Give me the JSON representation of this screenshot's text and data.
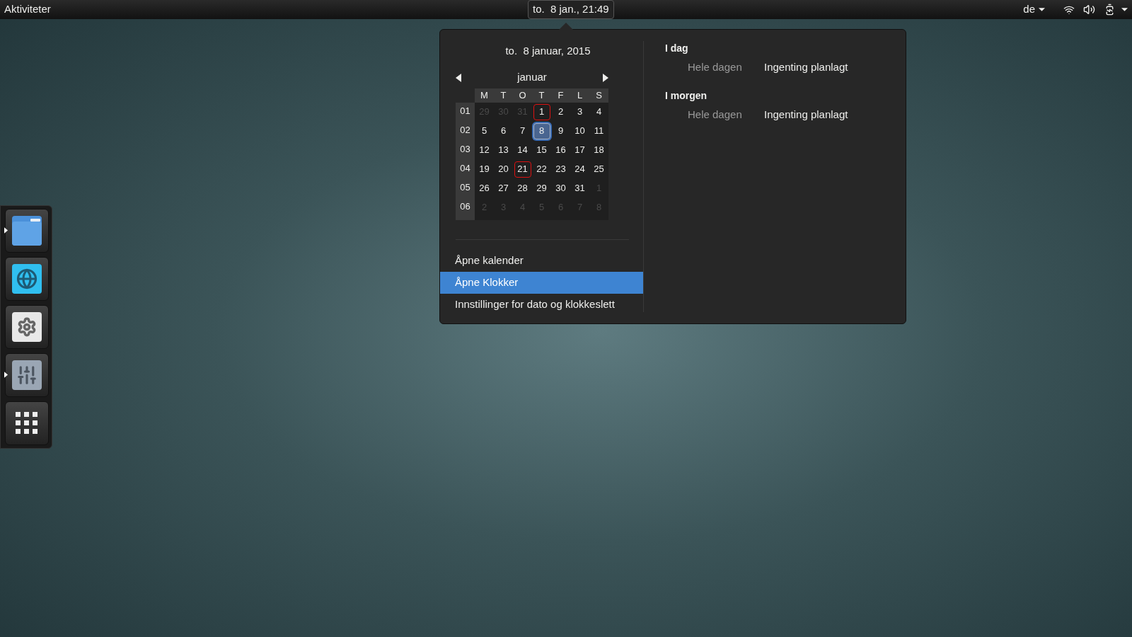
{
  "top_bar": {
    "activities": "Aktiviteter",
    "clock": "to.  8 jan., 21:49",
    "keyboard_layout": "de"
  },
  "calendar": {
    "date_title": "to.  8 januar, 2015",
    "month": "januar",
    "weekdays": [
      "M",
      "T",
      "O",
      "T",
      "F",
      "L",
      "S"
    ],
    "weeks": [
      {
        "number": "01",
        "days": [
          {
            "text": "29",
            "outside": true,
            "marked": false,
            "selected": false
          },
          {
            "text": "30",
            "outside": true,
            "marked": false,
            "selected": false
          },
          {
            "text": "31",
            "outside": true,
            "marked": false,
            "selected": false
          },
          {
            "text": "1",
            "outside": false,
            "marked": true,
            "selected": false
          },
          {
            "text": "2",
            "outside": false,
            "marked": false,
            "selected": false
          },
          {
            "text": "3",
            "outside": false,
            "marked": false,
            "selected": false
          },
          {
            "text": "4",
            "outside": false,
            "marked": false,
            "selected": false
          }
        ]
      },
      {
        "number": "02",
        "days": [
          {
            "text": "5",
            "outside": false,
            "marked": false,
            "selected": false
          },
          {
            "text": "6",
            "outside": false,
            "marked": false,
            "selected": false
          },
          {
            "text": "7",
            "outside": false,
            "marked": false,
            "selected": false
          },
          {
            "text": "8",
            "outside": false,
            "marked": false,
            "selected": true
          },
          {
            "text": "9",
            "outside": false,
            "marked": false,
            "selected": false
          },
          {
            "text": "10",
            "outside": false,
            "marked": false,
            "selected": false
          },
          {
            "text": "11",
            "outside": false,
            "marked": false,
            "selected": false
          }
        ]
      },
      {
        "number": "03",
        "days": [
          {
            "text": "12",
            "outside": false,
            "marked": false,
            "selected": false
          },
          {
            "text": "13",
            "outside": false,
            "marked": false,
            "selected": false
          },
          {
            "text": "14",
            "outside": false,
            "marked": false,
            "selected": false
          },
          {
            "text": "15",
            "outside": false,
            "marked": false,
            "selected": false
          },
          {
            "text": "16",
            "outside": false,
            "marked": false,
            "selected": false
          },
          {
            "text": "17",
            "outside": false,
            "marked": false,
            "selected": false
          },
          {
            "text": "18",
            "outside": false,
            "marked": false,
            "selected": false
          }
        ]
      },
      {
        "number": "04",
        "days": [
          {
            "text": "19",
            "outside": false,
            "marked": false,
            "selected": false
          },
          {
            "text": "20",
            "outside": false,
            "marked": false,
            "selected": false
          },
          {
            "text": "21",
            "outside": false,
            "marked": true,
            "selected": false
          },
          {
            "text": "22",
            "outside": false,
            "marked": false,
            "selected": false
          },
          {
            "text": "23",
            "outside": false,
            "marked": false,
            "selected": false
          },
          {
            "text": "24",
            "outside": false,
            "marked": false,
            "selected": false
          },
          {
            "text": "25",
            "outside": false,
            "marked": false,
            "selected": false
          }
        ]
      },
      {
        "number": "05",
        "days": [
          {
            "text": "26",
            "outside": false,
            "marked": false,
            "selected": false
          },
          {
            "text": "27",
            "outside": false,
            "marked": false,
            "selected": false
          },
          {
            "text": "28",
            "outside": false,
            "marked": false,
            "selected": false
          },
          {
            "text": "29",
            "outside": false,
            "marked": false,
            "selected": false
          },
          {
            "text": "30",
            "outside": false,
            "marked": false,
            "selected": false
          },
          {
            "text": "31",
            "outside": false,
            "marked": false,
            "selected": false
          },
          {
            "text": "1",
            "outside": true,
            "marked": false,
            "selected": false
          }
        ]
      },
      {
        "number": "06",
        "days": [
          {
            "text": "2",
            "outside": true,
            "marked": false,
            "selected": false
          },
          {
            "text": "3",
            "outside": true,
            "marked": false,
            "selected": false
          },
          {
            "text": "4",
            "outside": true,
            "marked": false,
            "selected": false
          },
          {
            "text": "5",
            "outside": true,
            "marked": false,
            "selected": false
          },
          {
            "text": "6",
            "outside": true,
            "marked": false,
            "selected": false
          },
          {
            "text": "7",
            "outside": true,
            "marked": false,
            "selected": false
          },
          {
            "text": "8",
            "outside": true,
            "marked": false,
            "selected": false
          }
        ]
      }
    ]
  },
  "menu": [
    {
      "label": "Åpne kalender",
      "selected": false
    },
    {
      "label": "Åpne Klokker",
      "selected": true
    },
    {
      "label": "Innstillinger for dato og klokkeslett",
      "selected": false
    }
  ],
  "events": [
    {
      "heading": "I dag",
      "time": "Hele dagen",
      "summary": "Ingenting planlagt"
    },
    {
      "heading": "I morgen",
      "time": "Hele dagen",
      "summary": "Ingenting planlagt"
    }
  ],
  "dock": [
    {
      "kind": "files",
      "running": true
    },
    {
      "kind": "web",
      "running": false
    },
    {
      "kind": "settings",
      "running": false
    },
    {
      "kind": "mixer",
      "running": true
    },
    {
      "kind": "apps",
      "running": false
    }
  ]
}
